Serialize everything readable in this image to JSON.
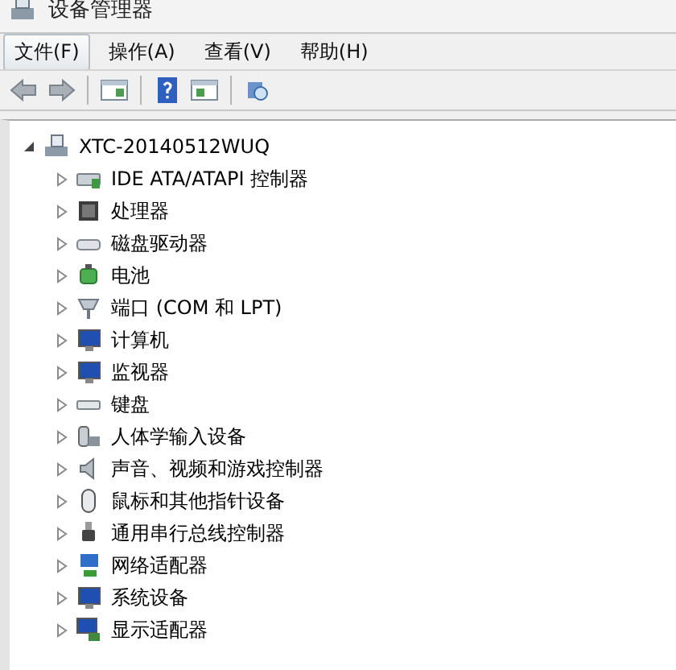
{
  "window": {
    "title": "设备管理器"
  },
  "menu": [
    {
      "label": "文件(F)",
      "selected": true
    },
    {
      "label": "操作(A)",
      "selected": false
    },
    {
      "label": "查看(V)",
      "selected": false
    },
    {
      "label": "帮助(H)",
      "selected": false
    }
  ],
  "toolbar": [
    {
      "kind": "back"
    },
    {
      "kind": "forward"
    },
    {
      "kind": "separator"
    },
    {
      "kind": "tree-pane"
    },
    {
      "kind": "separator"
    },
    {
      "kind": "help"
    },
    {
      "kind": "action-pane"
    },
    {
      "kind": "separator"
    },
    {
      "kind": "scan"
    }
  ],
  "tree": {
    "label": "XTC-20140512WUQ",
    "expanded": true,
    "children": [
      {
        "label": "IDE ATA/ATAPI 控制器",
        "kind": "controller",
        "expanded": false
      },
      {
        "label": "处理器",
        "kind": "cpu",
        "expanded": false
      },
      {
        "label": "磁盘驱动器",
        "kind": "disk",
        "expanded": false
      },
      {
        "label": "电池",
        "kind": "battery",
        "expanded": false
      },
      {
        "label": "端口 (COM 和 LPT)",
        "kind": "port",
        "expanded": false
      },
      {
        "label": "计算机",
        "kind": "monitor",
        "expanded": false
      },
      {
        "label": "监视器",
        "kind": "monitor",
        "expanded": false
      },
      {
        "label": "键盘",
        "kind": "keyboard",
        "expanded": false
      },
      {
        "label": "人体学输入设备",
        "kind": "hid",
        "expanded": false
      },
      {
        "label": "声音、视频和游戏控制器",
        "kind": "speaker",
        "expanded": false
      },
      {
        "label": "鼠标和其他指针设备",
        "kind": "mouse",
        "expanded": false
      },
      {
        "label": "通用串行总线控制器",
        "kind": "usb",
        "expanded": false
      },
      {
        "label": "网络适配器",
        "kind": "network",
        "expanded": false
      },
      {
        "label": "系统设备",
        "kind": "monitor",
        "expanded": false
      },
      {
        "label": "显示适配器",
        "kind": "display",
        "expanded": false
      }
    ]
  }
}
